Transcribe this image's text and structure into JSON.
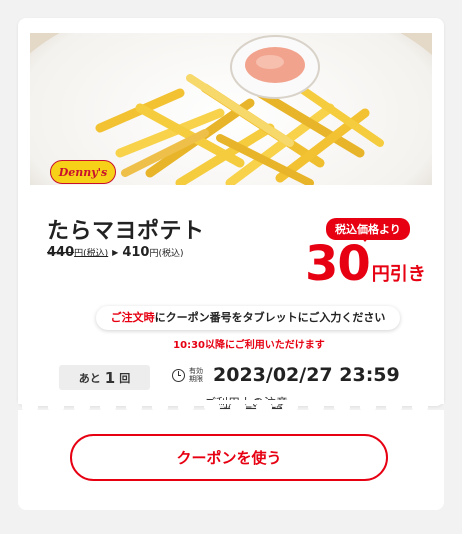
{
  "coupon": {
    "brand_logo_text": "Denny's",
    "product_name": "たらマヨポテト",
    "price_old": "440",
    "price_old_unit": "円(税込)",
    "price_arrow": "▶",
    "price_new": "410",
    "price_new_unit": "円(税込)",
    "discount_caption": "税込価格より",
    "discount_value": "30",
    "discount_unit": "円引き",
    "notice_highlight": "ご注文時",
    "notice_rest": "にクーポン番号をタブレットにご入力ください",
    "notice_time": "10:30以降にご利用いただけます",
    "remaining_prefix": "あと",
    "remaining_count": "1",
    "remaining_suffix": "回",
    "expiry_label": "有効期限",
    "expiry_datetime": "2023/02/27 23:59",
    "terms_link": "ご利用上の注意"
  },
  "actions": {
    "use_button": "クーポンを使う"
  },
  "colors": {
    "accent_red": "#e60012",
    "logo_yellow": "#f7d117"
  },
  "icons": {
    "clock": "clock-icon",
    "arrow": "triangle-right-icon"
  }
}
